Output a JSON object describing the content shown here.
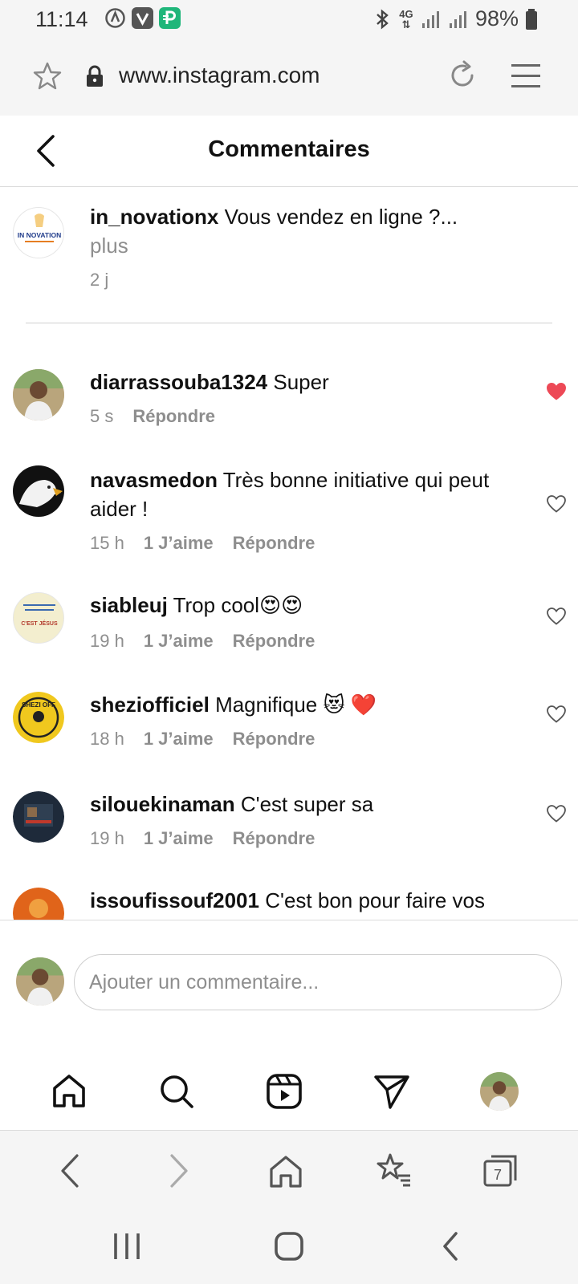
{
  "status_bar": {
    "time": "11:14",
    "network": "4G",
    "battery": "98%"
  },
  "browser": {
    "url": "www.instagram.com"
  },
  "header": {
    "title": "Commentaires"
  },
  "caption": {
    "username": "in_novationx",
    "text": "Vous vendez en ligne ?...",
    "more": "plus",
    "time": "2 j",
    "avatar_text": "IN NOVATION"
  },
  "comments": [
    {
      "username": "diarrassouba1324",
      "text": "Super",
      "time": "5 s",
      "likes": "",
      "reply": "Répondre",
      "liked": true
    },
    {
      "username": "navasmedon",
      "text": "Très bonne initiative qui peut",
      "text2": "aider !",
      "time": "15 h",
      "likes": "1 J’aime",
      "reply": "Répondre",
      "liked": false
    },
    {
      "username": "siableuj",
      "text": "Trop cool😍😍",
      "time": "19 h",
      "likes": "1 J’aime",
      "reply": "Répondre",
      "liked": false,
      "avatar_text": "C'EST JÉSUS"
    },
    {
      "username": "sheziofficiel",
      "text": "Magnifique 😻 ❤️",
      "time": "18 h",
      "likes": "1 J’aime",
      "reply": "Répondre",
      "liked": false,
      "avatar_text": "SHEZI OFF"
    },
    {
      "username": "silouekinaman",
      "text": "C'est super sa",
      "time": "19 h",
      "likes": "1 J’aime",
      "reply": "Répondre",
      "liked": false
    },
    {
      "username": "issoufissouf2001",
      "text": "C'est bon pour faire vos",
      "time": "",
      "likes": "",
      "reply": "",
      "liked": false
    }
  ],
  "comment_input": {
    "placeholder": "Ajouter un commentaire..."
  },
  "colors": {
    "heart_red": "#ed4956",
    "muted": "#8e8e8e",
    "text": "#111111"
  }
}
